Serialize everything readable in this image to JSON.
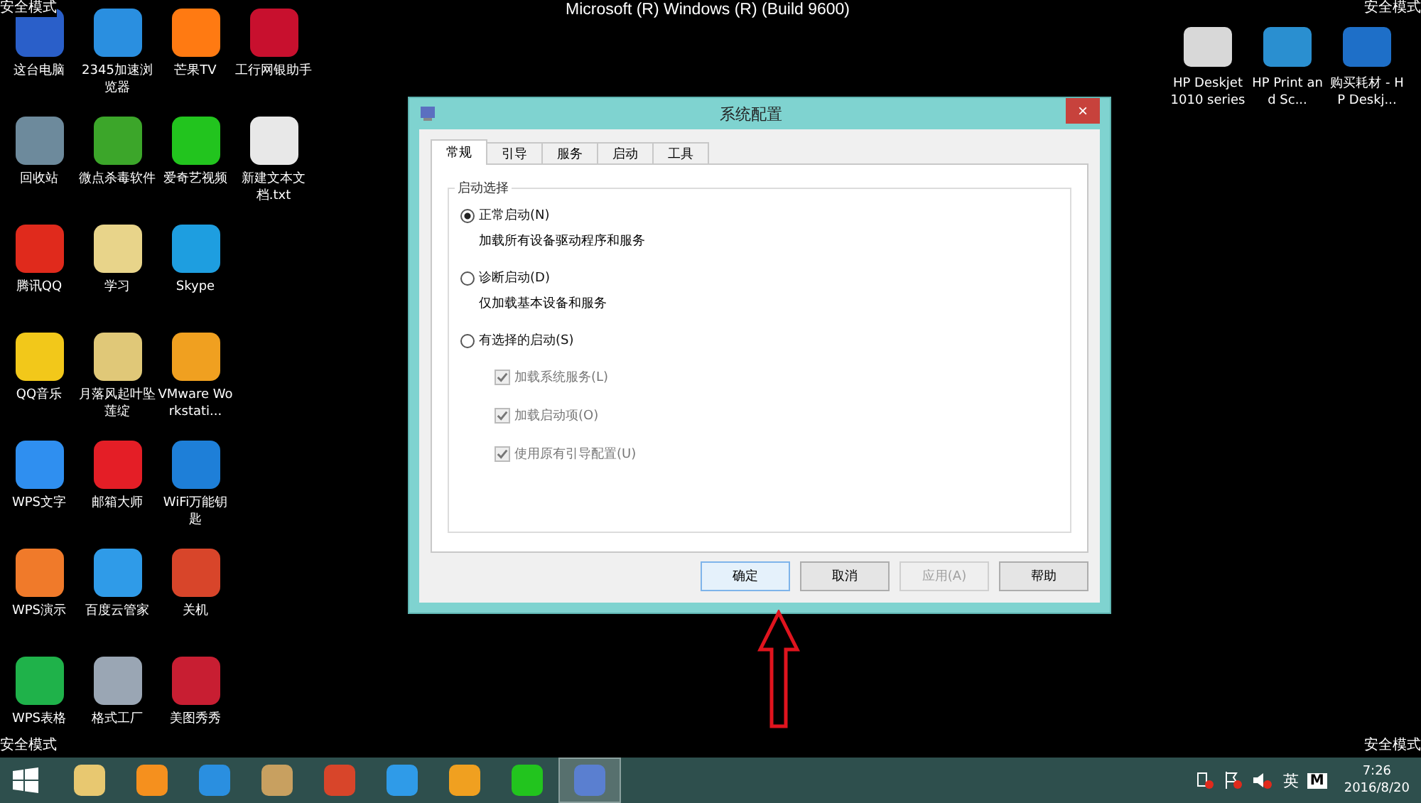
{
  "corner_labels": [
    "安全模式",
    "安全模式",
    "安全模式",
    "安全模式"
  ],
  "header": "Microsoft (R) Windows (R) (Build 9600)",
  "desktop_left": [
    [
      {
        "label": "这台电脑",
        "color": "#2a5fc9"
      },
      {
        "label": "回收站",
        "color": "#6d8a9c"
      },
      {
        "label": "腾讯QQ",
        "color": "#e02a1c"
      },
      {
        "label": "QQ音乐",
        "color": "#f2c81a"
      },
      {
        "label": "WPS文字",
        "color": "#2f8ff0"
      },
      {
        "label": "WPS演示",
        "color": "#f07a2a"
      },
      {
        "label": "WPS表格",
        "color": "#1fb24a"
      }
    ],
    [
      {
        "label": "2345加速浏览器",
        "color": "#2a8fe0"
      },
      {
        "label": "微点杀毒软件",
        "color": "#3ca62a"
      },
      {
        "label": "学习",
        "color": "#e8d48a"
      },
      {
        "label": "月落风起叶坠莲绽",
        "color": "#e0c878"
      },
      {
        "label": "邮箱大师",
        "color": "#e41e26"
      },
      {
        "label": "百度云管家",
        "color": "#2f9be8"
      },
      {
        "label": "格式工厂",
        "color": "#9aa6b4"
      }
    ],
    [
      {
        "label": "芒果TV",
        "color": "#ff7a12"
      },
      {
        "label": "爱奇艺视频",
        "color": "#22c41e"
      },
      {
        "label": "Skype",
        "color": "#1e9ee0"
      },
      {
        "label": "VMware Workstati...",
        "color": "#f0a020"
      },
      {
        "label": "WiFi万能钥匙",
        "color": "#1e7fd8"
      },
      {
        "label": "关机",
        "color": "#d8452a"
      },
      {
        "label": "美图秀秀",
        "color": "#c81e32"
      }
    ],
    [
      {
        "label": "工行网银助手",
        "color": "#c8102e"
      },
      {
        "label": "新建文本文档.txt",
        "color": "#e8e8e8"
      }
    ]
  ],
  "desktop_right": [
    {
      "label": "HP Deskjet 1010 series",
      "color": "#d8d8d8"
    },
    {
      "label": "HP Print and Sc...",
      "color": "#2a8fd0"
    },
    {
      "label": "购买耗材 - HP Deskj...",
      "color": "#1e6fc8"
    }
  ],
  "dialog": {
    "title": "系统配置",
    "close": "×",
    "tabs": [
      {
        "label": "常规",
        "selected": true
      },
      {
        "label": "引导",
        "selected": false
      },
      {
        "label": "服务",
        "selected": false
      },
      {
        "label": "启动",
        "selected": false
      },
      {
        "label": "工具",
        "selected": false
      }
    ],
    "group_title": "启动选择",
    "options": [
      {
        "kind": "radio",
        "label": "正常启动(N)",
        "description": "加载所有设备驱动程序和服务",
        "selected": true
      },
      {
        "kind": "radio",
        "label": "诊断启动(D)",
        "description": "仅加载基本设备和服务",
        "selected": false
      },
      {
        "kind": "radio",
        "label": "有选择的启动(S)",
        "selected": false
      },
      {
        "kind": "checkbox",
        "label": "加载系统服务(L)",
        "checked": true,
        "disabled": true
      },
      {
        "kind": "checkbox",
        "label": "加载启动项(O)",
        "checked": true,
        "disabled": true
      },
      {
        "kind": "checkbox",
        "label": "使用原有引导配置(U)",
        "checked": true,
        "disabled": true
      }
    ],
    "buttons": [
      {
        "label": "确定",
        "default": true,
        "disabled": false
      },
      {
        "label": "取消",
        "default": false,
        "disabled": false
      },
      {
        "label": "应用(A)",
        "default": false,
        "disabled": true
      },
      {
        "label": "帮助",
        "default": false,
        "disabled": false
      }
    ]
  },
  "taskbar": {
    "apps": [
      {
        "color": "#e8c870",
        "selected": false
      },
      {
        "color": "#f5901e",
        "selected": false
      },
      {
        "color": "#2a8fe0",
        "selected": false
      },
      {
        "color": "#c8a060",
        "selected": false
      },
      {
        "color": "#d8452a",
        "selected": false
      },
      {
        "color": "#2f9be8",
        "selected": false
      },
      {
        "color": "#f0a020",
        "selected": false
      },
      {
        "color": "#22c41e",
        "selected": false
      },
      {
        "color": "#5a7fd0",
        "selected": true
      }
    ],
    "ime": "英",
    "ime_mode": "M",
    "time": "7:26",
    "date": "2016/8/20"
  }
}
